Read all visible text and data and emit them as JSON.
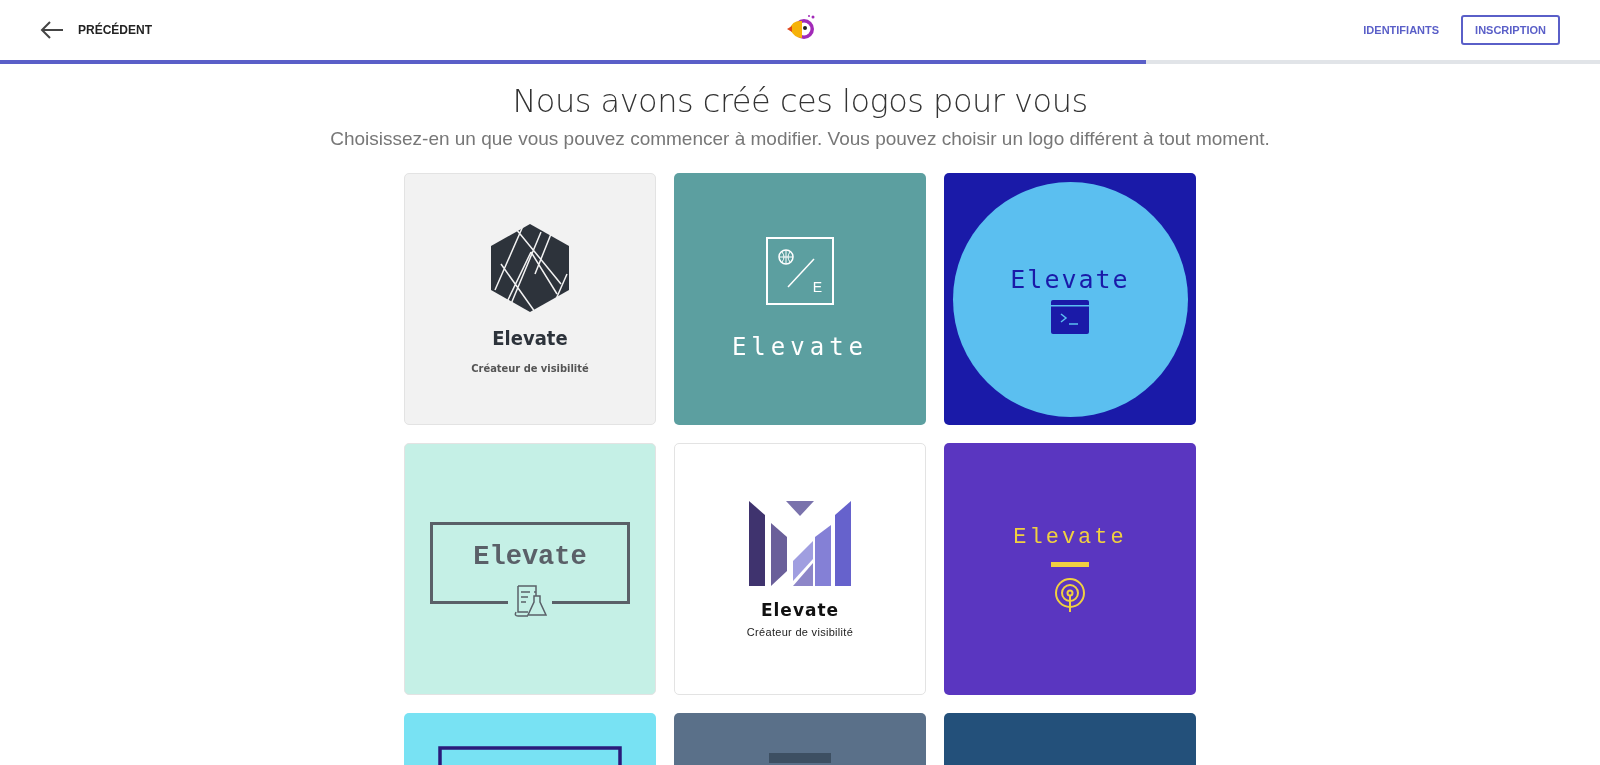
{
  "header": {
    "back_label": "PRÉCÉDENT",
    "login_link": "IDENTIFIANTS",
    "signup_button": "INSCRIPTION"
  },
  "progress": {
    "level": 0.716
  },
  "title": "Nous avons créé ces logos pour vous",
  "subtitle": "Choisissez-en un que vous pouvez commencer à modifier. Vous pouvez choisir un logo différent à tout moment.",
  "logos": [
    {
      "kind": "hexagon",
      "name": "Elevate",
      "tagline": "Créateur de visibilité"
    },
    {
      "kind": "globe",
      "name": "Elevate",
      "monogram": "E"
    },
    {
      "kind": "terminal",
      "name": "Elevate"
    },
    {
      "kind": "frame",
      "name": "Elevate"
    },
    {
      "kind": "bars",
      "name": "Elevate",
      "tagline": "Créateur de visibilité"
    },
    {
      "kind": "podcast",
      "name": "Elevate"
    },
    {
      "kind": "cyan"
    },
    {
      "kind": "slate"
    },
    {
      "kind": "navy"
    }
  ]
}
